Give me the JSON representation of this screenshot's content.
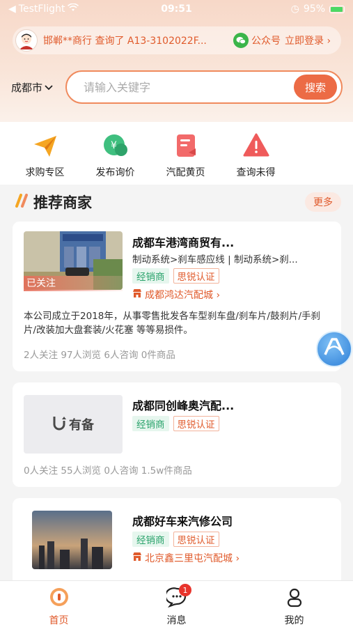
{
  "status_bar": {
    "carrier": "TestFlight",
    "time": "09:51",
    "battery": "95%"
  },
  "notice": {
    "text": "邯郸**商行 查询了 A13-3102022F...",
    "gzh_label": "公众号",
    "login_label": "立即登录 ›"
  },
  "search": {
    "city": "成都市",
    "placeholder": "请输入关键字",
    "button_label": "搜索"
  },
  "quick_menu": [
    {
      "label": "求购专区",
      "icon": "paper-plane-icon"
    },
    {
      "label": "发布询价",
      "icon": "price-bubble-icon"
    },
    {
      "label": "汽配黄页",
      "icon": "document-icon"
    },
    {
      "label": "查询未得",
      "icon": "warning-icon"
    }
  ],
  "section": {
    "title": "推荐商家",
    "more_label": "更多"
  },
  "merchants": [
    {
      "name": "成都车港湾商贸有...",
      "category": "制动系统>刹车感应线 | 制动系统>刹...",
      "tag_type": "经销商",
      "tag_cert": "思锐认证",
      "mall": "成都鸿达汽配城 ›",
      "followed_label": "已关注",
      "desc": "本公司成立于2018年，从事零售批发各车型刹车盘/刹车片/鼓刹片/手刹片/改装加大盘套装/火花塞 等等易损件。",
      "stats": "2人关注 97人浏览 6人咨询 0件商品"
    },
    {
      "name": "成都同创峰奥汽配...",
      "tag_type": "经销商",
      "tag_cert": "思锐认证",
      "logo_text": "有备",
      "stats": "0人关注 55人浏览 0人咨询 1.5w件商品"
    },
    {
      "name": "成都好车来汽修公司",
      "tag_type": "经销商",
      "tag_cert": "思锐认证",
      "mall": "北京鑫三里屯汽配城 ›"
    }
  ],
  "tabbar": {
    "home": "首页",
    "messages": "消息",
    "messages_badge": "1",
    "mine": "我的"
  },
  "colors": {
    "accent": "#e05a2b",
    "green_tag": "#2ba36c"
  }
}
